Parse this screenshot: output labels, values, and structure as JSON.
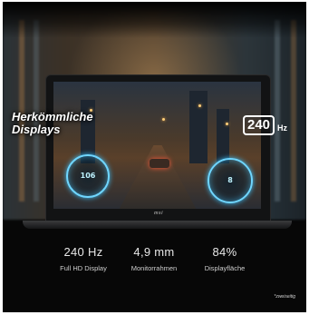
{
  "headline": {
    "line1": "Herkömmliche",
    "line2": "Displays"
  },
  "badge": {
    "value": "240",
    "unit": "Hz"
  },
  "brand": "msi",
  "hud": {
    "left_gauge": "106",
    "right_gauge": "8"
  },
  "stats": [
    {
      "value": "240 Hz",
      "label": "Full HD Display"
    },
    {
      "value": "4,9 mm",
      "label": "Monitorrahmen"
    },
    {
      "value": "84%",
      "label": "Displayfläche"
    }
  ],
  "footnote": "*zweiseitig"
}
